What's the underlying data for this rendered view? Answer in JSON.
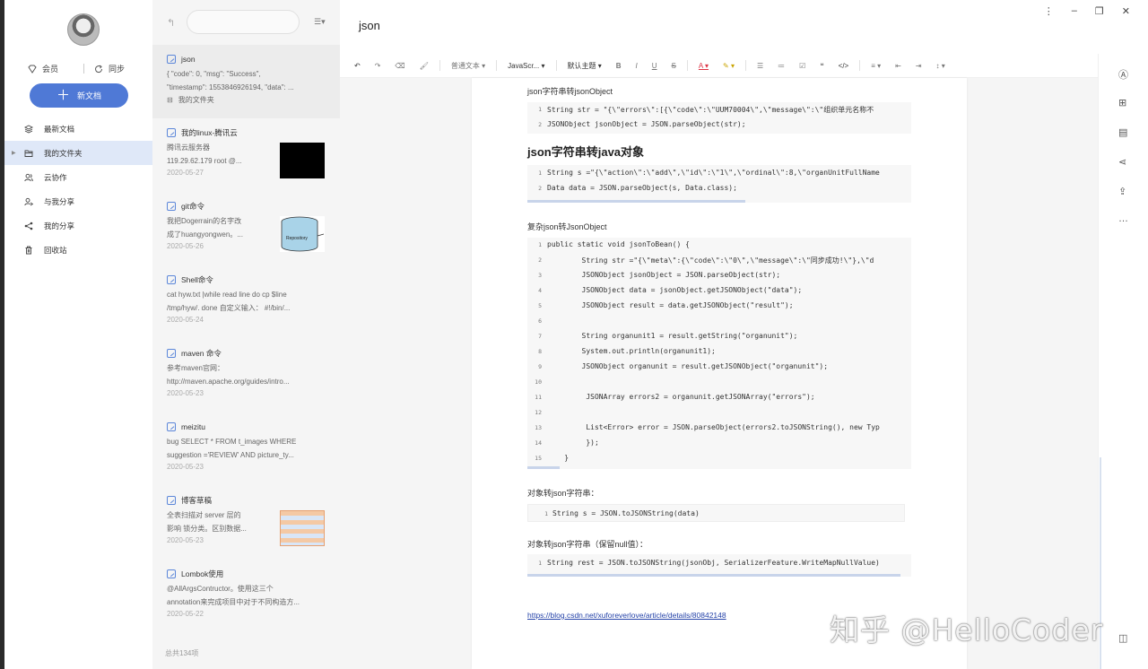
{
  "sidebar": {
    "vip_label": "会员",
    "sync_label": "同步",
    "new_doc_label": "新文档",
    "items": [
      {
        "label": "最新文档",
        "icon": "layers-icon"
      },
      {
        "label": "我的文件夹",
        "icon": "folder-icon"
      },
      {
        "label": "云协作",
        "icon": "users-icon"
      },
      {
        "label": "与我分享",
        "icon": "user-share-icon"
      },
      {
        "label": "我的分享",
        "icon": "share-icon"
      },
      {
        "label": "回收站",
        "icon": "trash-icon"
      }
    ]
  },
  "list": {
    "search_placeholder": "",
    "footer": "总共134项",
    "docs": [
      {
        "title": "json",
        "lines": [
          "{ \"code\": 0, \"msg\": \"Success\",",
          "\"timestamp\": 1553846926194, \"data\": ..."
        ],
        "folder": "我的文件夹",
        "date": ""
      },
      {
        "title": "我的linux-腾讯云",
        "lines": [
          "腾讯云服务器",
          "119.29.62.179 root @..."
        ],
        "date": "2020-05-27",
        "thumb": "black"
      },
      {
        "title": "git命令",
        "lines": [
          "我把Dogerrain的名字改",
          "成了huangyongwen。..."
        ],
        "date": "2020-05-26",
        "thumb": "repo",
        "thumb_label": "Repository"
      },
      {
        "title": "Shell命令",
        "lines": [
          "cat hyw.txt |while read line do cp $line",
          "/tmp/hyw/. done 自定义输入： #!/bin/..."
        ],
        "date": "2020-05-24"
      },
      {
        "title": "maven 命令",
        "lines": [
          "参考maven官网：",
          "http://maven.apache.org/guides/intro..."
        ],
        "date": "2020-05-23"
      },
      {
        "title": "meizitu",
        "lines": [
          "bug SELECT * FROM t_images WHERE",
          "suggestion ='REVIEW' AND picture_ty..."
        ],
        "date": "2020-05-23"
      },
      {
        "title": "博客草稿",
        "lines": [
          "全表扫描对 server 层的",
          "影响 锁分类。区别数据..."
        ],
        "date": "2020-05-23",
        "thumb": "chart"
      },
      {
        "title": "Lombok使用",
        "lines": [
          "@AllArgsContructor。使用这三个",
          "annotation来完成项目中对于不同构造方..."
        ],
        "date": "2020-05-22"
      }
    ]
  },
  "editor": {
    "title": "json",
    "toolbar": {
      "paragraph": "普通文本",
      "language": "JavaScr...",
      "theme": "默认主题"
    },
    "sections": {
      "s1": "json字符串转jsonObject",
      "s2": "json字符串转java对象",
      "s3": "复杂json转JsonObject",
      "s4": "对象转json字符串：",
      "s5": "对象转json字符串（保留null值）："
    },
    "link": "https://blog.csdn.net/xuforeverlove/article/details/80842148",
    "watermark": "知乎 @HelloCoder"
  },
  "code_blocks": {
    "b1": [
      {
        "n": "1",
        "t": "String str = \"{\\\"errors\\\":[{\\\"code\\\":\\\"UUM70004\\\",\\\"message\\\":\\\"组织单元名称不"
      },
      {
        "n": "2",
        "t": "JSONObject jsonObject = JSON.parseObject(str);"
      }
    ],
    "b2": [
      {
        "n": "1",
        "t": "String s =\"{\\\"action\\\":\\\"add\\\",\\\"id\\\":\\\"1\\\",\\\"ordinal\\\":8,\\\"organUnitFullName"
      },
      {
        "n": "2",
        "t": "Data data = JSON.parseObject(s, Data.class);"
      }
    ],
    "b3": [
      {
        "n": "1",
        "t": "public static void jsonToBean() {"
      },
      {
        "n": "2",
        "t": "        String str =\"{\\\"meta\\\":{\\\"code\\\":\\\"0\\\",\\\"message\\\":\\\"同步成功!\\\"},\\\"d"
      },
      {
        "n": "3",
        "t": "        JSONObject jsonObject = JSON.parseObject(str);"
      },
      {
        "n": "4",
        "t": "        JSONObject data = jsonObject.getJSONObject(\"data\");"
      },
      {
        "n": "5",
        "t": "        JSONObject result = data.getJSONObject(\"result\");"
      },
      {
        "n": "6",
        "t": ""
      },
      {
        "n": "7",
        "t": "        String organunit1 = result.getString(\"organunit\");"
      },
      {
        "n": "8",
        "t": "        System.out.println(organunit1);"
      },
      {
        "n": "9",
        "t": "        JSONObject organunit = result.getJSONObject(\"organunit\");"
      },
      {
        "n": "10",
        "t": ""
      },
      {
        "n": "11",
        "t": "         JSONArray errors2 = organunit.getJSONArray(\"errors\");"
      },
      {
        "n": "12",
        "t": ""
      },
      {
        "n": "13",
        "t": "         List<Error> error = JSON.parseObject(errors2.toJSONString(), new Typ"
      },
      {
        "n": "14",
        "t": "         });"
      },
      {
        "n": "15",
        "t": "    }"
      }
    ],
    "b4": [
      {
        "n": "1",
        "t": "String s = JSON.toJSONString(data)"
      }
    ],
    "b5": [
      {
        "n": "1",
        "t": "String rest = JSON.toJSONString(jsonObj, SerializerFeature.WriteMapNullValue)"
      }
    ]
  }
}
